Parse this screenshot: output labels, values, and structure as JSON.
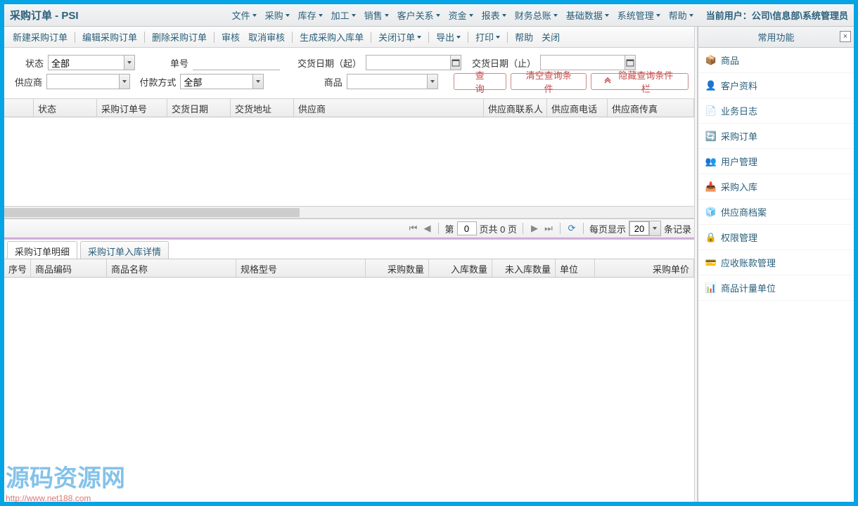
{
  "header": {
    "title": "采购订单 - PSI",
    "menus": [
      "文件",
      "采购",
      "库存",
      "加工",
      "销售",
      "客户关系",
      "资金",
      "报表",
      "财务总账",
      "基础数据",
      "系统管理",
      "帮助"
    ],
    "user_label": "当前用户：",
    "user_value": "公司\\信息部\\系统管理员"
  },
  "toolbar": {
    "items": [
      "新建采购订单",
      "编辑采购订单",
      "删除采购订单",
      "审核",
      "取消审核",
      "生成采购入库单",
      "关闭订单",
      "导出",
      "打印",
      "帮助",
      "关闭"
    ]
  },
  "filters": {
    "status_label": "状态",
    "status_value": "全部",
    "billno_label": "单号",
    "deliver_from_label": "交货日期（起）",
    "deliver_to_label": "交货日期（止）",
    "supplier_label": "供应商",
    "payment_label": "付款方式",
    "payment_value": "全部",
    "goods_label": "商品",
    "query_btn": "查询",
    "clear_btn": "清空查询条件",
    "hide_btn": "隐藏查询条件栏"
  },
  "grid1": {
    "cols": [
      "",
      "状态",
      "采购订单号",
      "交货日期",
      "交货地址",
      "供应商",
      "供应商联系人",
      "供应商电话",
      "供应商传真"
    ]
  },
  "pager": {
    "page_prefix": "第",
    "page_value": "0",
    "page_mid": "页共 0 页",
    "per_page_label": "每页显示",
    "per_page_value": "20",
    "records_label": "条记录"
  },
  "detail_tabs": [
    "采购订单明细",
    "采购订单入库详情"
  ],
  "grid2": {
    "cols": [
      "序号",
      "商品编码",
      "商品名称",
      "规格型号",
      "采购数量",
      "入库数量",
      "未入库数量",
      "单位",
      "采购单价"
    ]
  },
  "side": {
    "title": "常用功能",
    "items": [
      {
        "icon": "📦",
        "label": "商品"
      },
      {
        "icon": "👤",
        "label": "客户资料"
      },
      {
        "icon": "📄",
        "label": "业务日志"
      },
      {
        "icon": "🔄",
        "label": "采购订单"
      },
      {
        "icon": "👥",
        "label": "用户管理"
      },
      {
        "icon": "📥",
        "label": "采购入库"
      },
      {
        "icon": "🧊",
        "label": "供应商档案"
      },
      {
        "icon": "🔒",
        "label": "权限管理"
      },
      {
        "icon": "💳",
        "label": "应收账款管理"
      },
      {
        "icon": "📊",
        "label": "商品计量单位"
      }
    ]
  },
  "watermark": {
    "text": "源码资源网",
    "url": "http://www.net188.com"
  }
}
